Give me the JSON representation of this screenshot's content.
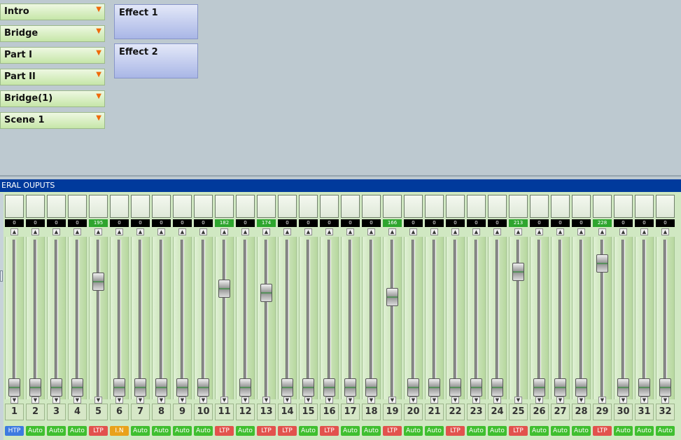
{
  "scenes": [
    {
      "label": "Intro",
      "icon": "dropdown-arrow-icon"
    },
    {
      "label": "Bridge",
      "icon": "dropdown-arrow-icon"
    },
    {
      "label": "Part I",
      "icon": "dropdown-arrow-icon"
    },
    {
      "label": "Part II",
      "icon": "dropdown-arrow-icon"
    },
    {
      "label": "Bridge(1)",
      "icon": "dropdown-arrow-icon"
    },
    {
      "label": "Scene 1",
      "icon": "dropdown-arrow-icon"
    }
  ],
  "effects": [
    {
      "label": "Effect 1"
    },
    {
      "label": "Effect 2"
    }
  ],
  "panel": {
    "title": "ERAL OUPUTS"
  },
  "colors": {
    "HTP": "#3d7be0",
    "Auto": "#3fbf2f",
    "LTP": "#e2524d",
    "I.N": "#e9a21a"
  },
  "channels": [
    {
      "num": "1",
      "value": "0",
      "mode": "HTP",
      "level": 0
    },
    {
      "num": "2",
      "value": "0",
      "mode": "Auto",
      "level": 0
    },
    {
      "num": "3",
      "value": "0",
      "mode": "Auto",
      "level": 0
    },
    {
      "num": "4",
      "value": "0",
      "mode": "Auto",
      "level": 0
    },
    {
      "num": "5",
      "value": "195",
      "mode": "LTP",
      "level": 195
    },
    {
      "num": "6",
      "value": "0",
      "mode": "I.N",
      "level": 0
    },
    {
      "num": "7",
      "value": "0",
      "mode": "Auto",
      "level": 0
    },
    {
      "num": "8",
      "value": "0",
      "mode": "Auto",
      "level": 0
    },
    {
      "num": "9",
      "value": "0",
      "mode": "Auto",
      "level": 0
    },
    {
      "num": "10",
      "value": "0",
      "mode": "Auto",
      "level": 0
    },
    {
      "num": "11",
      "value": "182",
      "mode": "LTP",
      "level": 182
    },
    {
      "num": "12",
      "value": "0",
      "mode": "Auto",
      "level": 0
    },
    {
      "num": "13",
      "value": "174",
      "mode": "LTP",
      "level": 174
    },
    {
      "num": "14",
      "value": "0",
      "mode": "LTP",
      "level": 0
    },
    {
      "num": "15",
      "value": "0",
      "mode": "Auto",
      "level": 0
    },
    {
      "num": "16",
      "value": "0",
      "mode": "LTP",
      "level": 0
    },
    {
      "num": "17",
      "value": "0",
      "mode": "Auto",
      "level": 0
    },
    {
      "num": "18",
      "value": "0",
      "mode": "Auto",
      "level": 0
    },
    {
      "num": "19",
      "value": "166",
      "mode": "LTP",
      "level": 166
    },
    {
      "num": "20",
      "value": "0",
      "mode": "Auto",
      "level": 0
    },
    {
      "num": "21",
      "value": "0",
      "mode": "Auto",
      "level": 0
    },
    {
      "num": "22",
      "value": "0",
      "mode": "LTP",
      "level": 0
    },
    {
      "num": "23",
      "value": "0",
      "mode": "Auto",
      "level": 0
    },
    {
      "num": "24",
      "value": "0",
      "mode": "Auto",
      "level": 0
    },
    {
      "num": "25",
      "value": "213",
      "mode": "LTP",
      "level": 213
    },
    {
      "num": "26",
      "value": "0",
      "mode": "Auto",
      "level": 0
    },
    {
      "num": "27",
      "value": "0",
      "mode": "Auto",
      "level": 0
    },
    {
      "num": "28",
      "value": "0",
      "mode": "Auto",
      "level": 0
    },
    {
      "num": "29",
      "value": "228",
      "mode": "LTP",
      "level": 228
    },
    {
      "num": "30",
      "value": "0",
      "mode": "Auto",
      "level": 0
    },
    {
      "num": "31",
      "value": "0",
      "mode": "Auto",
      "level": 0
    },
    {
      "num": "32",
      "value": "0",
      "mode": "Auto",
      "level": 0
    }
  ]
}
